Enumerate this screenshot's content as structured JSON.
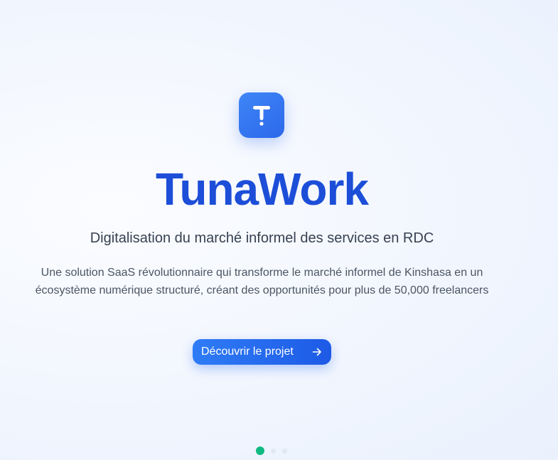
{
  "hero": {
    "brand_title": "TunaWork",
    "tagline": "Digitalisation du marché informel des services en RDC",
    "description": "Une solution SaaS révolutionnaire qui transforme le marché informel de Kinshasa en un écosystème numérique structuré, créant des opportunités pour plus de 50,000 freelancers",
    "cta_label": "Découvrir le projet",
    "cta_icon": "arrow-right-icon",
    "logo_icon": "tunawork-logo-icon"
  },
  "carousel": {
    "slide_count": 3,
    "active_index": 0
  },
  "colors": {
    "brand_blue": "#1d4ed8",
    "logo_tile": "#3a7cf5",
    "button_blue": "#2563eb",
    "active_dot": "#10b981",
    "inactive_dot": "#e2e8f0"
  }
}
